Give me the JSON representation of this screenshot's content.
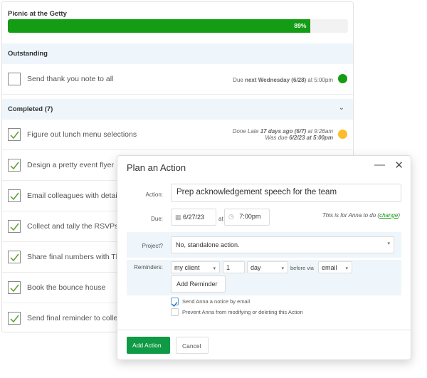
{
  "project": {
    "title": "Picnic at the Getty",
    "progress_percent": 89,
    "progress_label": "89%"
  },
  "outstanding": {
    "header": "Outstanding",
    "items": [
      {
        "text": "Send thank you note to all",
        "due_prefix": "Due ",
        "due_bold": "next Wednesday (6/28)",
        "due_suffix": " at 5:00pm",
        "status_color": "#139c14",
        "checked": false
      }
    ]
  },
  "completed": {
    "header": "Completed (7)",
    "items": [
      {
        "text": "Figure out lunch menu selections",
        "line1_prefix": "Done Late ",
        "line1_bold": "17 days ago (6/7)",
        "line1_suffix": " at 9:26am",
        "line2_prefix": "Was due ",
        "line2_bold": "6/2/23 at 5:00pm",
        "status_color": "#fbbd2e"
      },
      {
        "text": "Design a pretty event flyer"
      },
      {
        "text": "Email colleagues with detai"
      },
      {
        "text": "Collect and tally the RSVPs"
      },
      {
        "text": "Share final numbers with Th"
      },
      {
        "text": "Book the bounce house"
      },
      {
        "text": "Send final reminder to colle"
      }
    ]
  },
  "modal": {
    "title": "Plan an Action",
    "action_label": "Action:",
    "action_value": "Prep acknowledgement speech for the team",
    "due_label": "Due:",
    "due_date": "6/27/23",
    "at": "at",
    "due_time": "7:00pm",
    "assignee_prefix": "This is for Anna to do (",
    "assignee_link": "change",
    "assignee_suffix": ")",
    "project_label": "Project?",
    "project_value": "No, standalone action.",
    "reminders_label": "Reminders:",
    "reminder_who": "my client",
    "reminder_count": "1",
    "reminder_unit": "day",
    "before_via": "before via",
    "reminder_channel": "email",
    "add_reminder": "Add Reminder",
    "notice_label": "Send Anna a notice by email",
    "notice_checked": true,
    "prevent_label": "Prevent Anna from modifying or deleting this Action",
    "prevent_checked": false,
    "submit": "Add Action",
    "cancel": "Cancel",
    "accent": "#0f9a45"
  }
}
